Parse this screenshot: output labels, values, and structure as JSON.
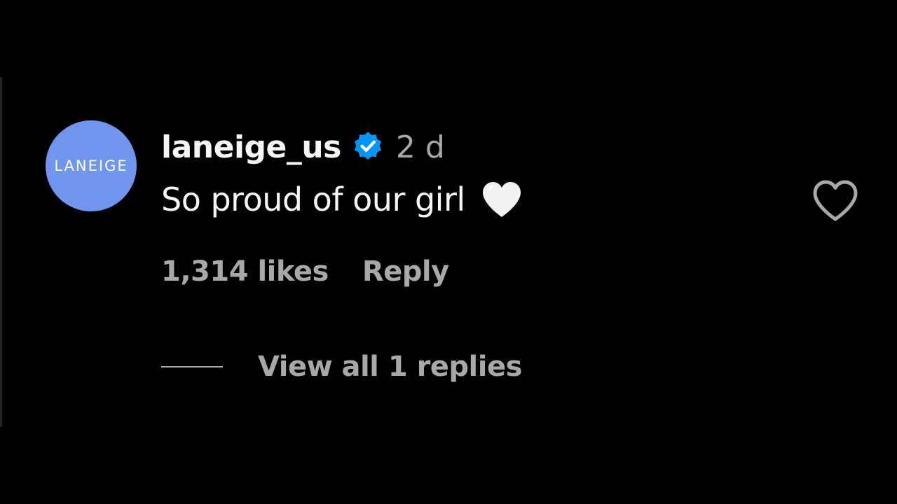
{
  "comment": {
    "avatar_text": "LANEIGE",
    "username": "laneige_us",
    "timestamp": "2 d",
    "text": "So proud of our girl",
    "likes": "1,314 likes",
    "reply_label": "Reply",
    "view_replies_label": "View all 1 replies"
  },
  "icons": {
    "verified": "verified-badge-icon",
    "comment_emoji": "white-heart-emoji",
    "like": "heart-outline-icon"
  },
  "colors": {
    "background": "#000000",
    "avatar": "#6f95ef",
    "verified": "#0095f6",
    "primary_text": "#f5f5f5",
    "secondary_text": "#a8a8a8"
  }
}
